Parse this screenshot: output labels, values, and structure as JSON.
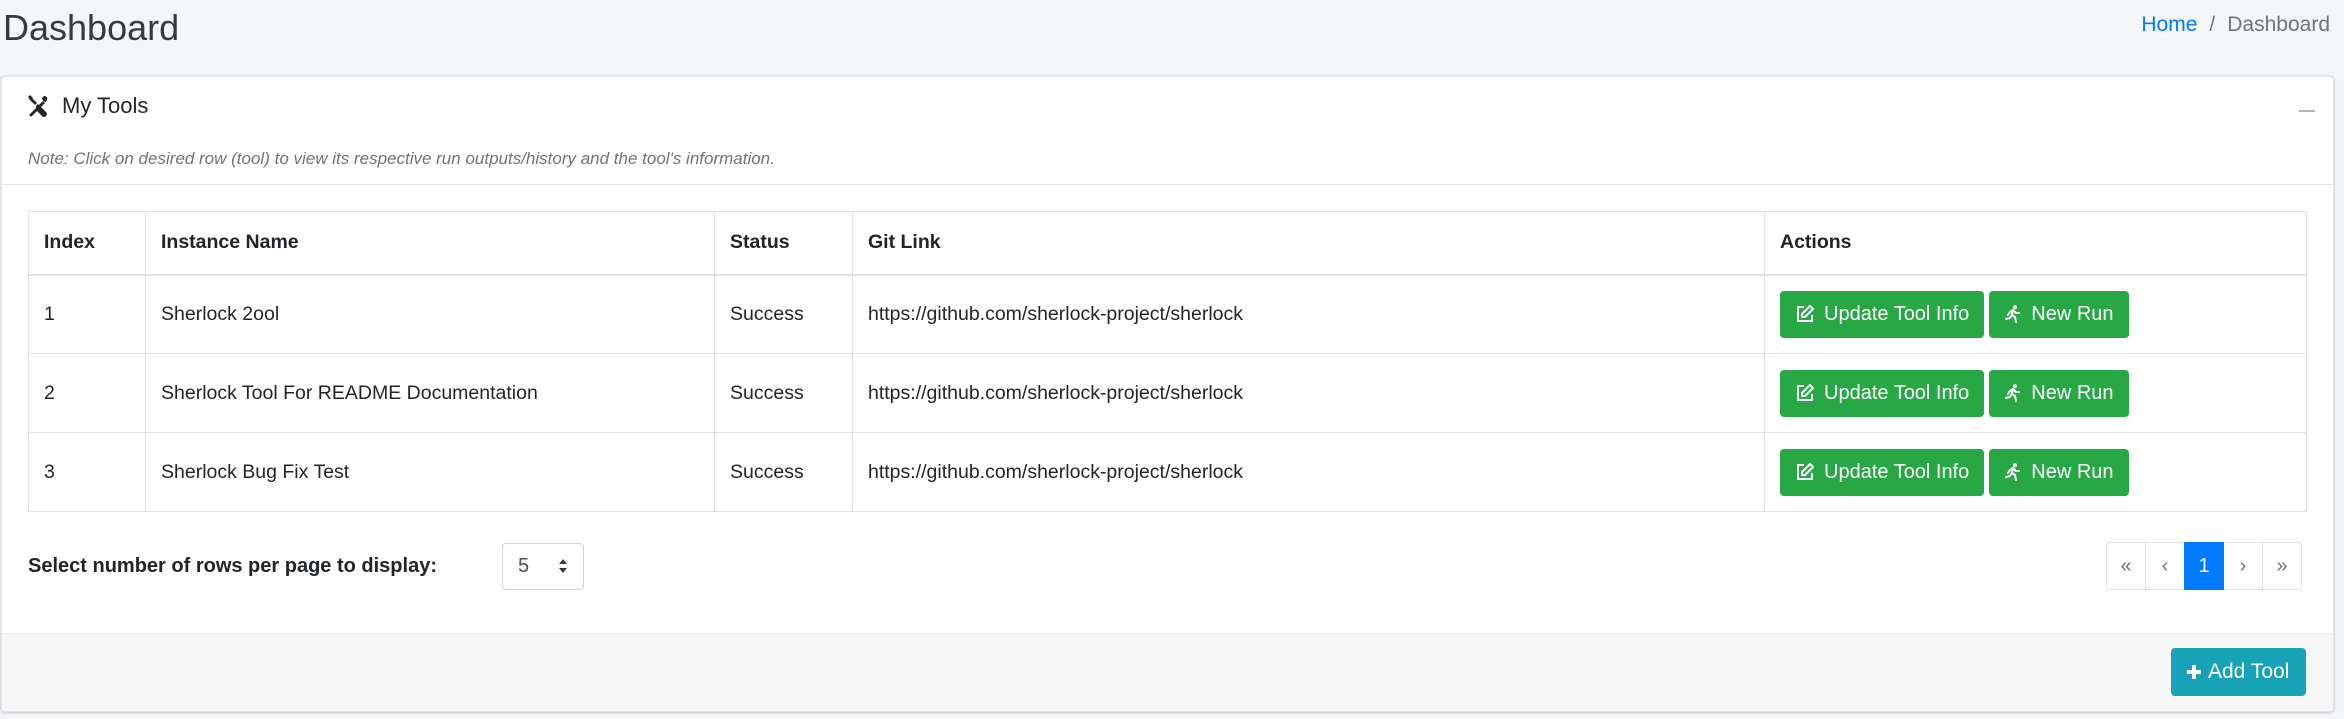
{
  "header": {
    "title": "Dashboard",
    "breadcrumb": {
      "home": "Home",
      "separator": "/",
      "current": "Dashboard"
    }
  },
  "card": {
    "title": "My Tools",
    "title_icon": "tools-icon",
    "collapse_icon": "minus-icon",
    "note": "Note: Click on desired row (tool) to view its respective run outputs/history and the tool's information."
  },
  "table": {
    "columns": [
      "Index",
      "Instance Name",
      "Status",
      "Git Link",
      "Actions"
    ],
    "rows": [
      {
        "index": "1",
        "name": "Sherlock 2ool",
        "status": "Success",
        "git": "https://github.com/sherlock-project/sherlock"
      },
      {
        "index": "2",
        "name": "Sherlock Tool For README Documentation",
        "status": "Success",
        "git": "https://github.com/sherlock-project/sherlock"
      },
      {
        "index": "3",
        "name": "Sherlock Bug Fix Test",
        "status": "Success",
        "git": "https://github.com/sherlock-project/sherlock"
      }
    ],
    "actions": {
      "update_label": "Update Tool Info",
      "update_icon": "edit-icon",
      "run_label": "New Run",
      "run_icon": "running-icon"
    }
  },
  "rows_per_page": {
    "label": "Select number of rows per page to display:",
    "value": "5"
  },
  "pagination": {
    "first": "«",
    "prev": "‹",
    "current": "1",
    "next": "›",
    "last": "»"
  },
  "footer": {
    "add_label": "Add Tool",
    "add_icon": "plus-icon"
  },
  "colors": {
    "success": "#28a745",
    "info": "#17a2b8",
    "primary": "#007bff",
    "background": "#f4f6f9"
  }
}
